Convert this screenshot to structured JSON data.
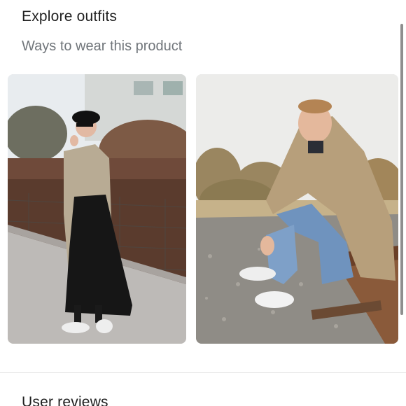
{
  "explore": {
    "title": "Explore outfits",
    "subtitle": "Ways to wear this product"
  },
  "outfits": [
    {
      "icon": "photo-woman-trench-coat"
    },
    {
      "icon": "photo-man-trench-coat"
    }
  ],
  "reviews": {
    "title": "User reviews"
  }
}
